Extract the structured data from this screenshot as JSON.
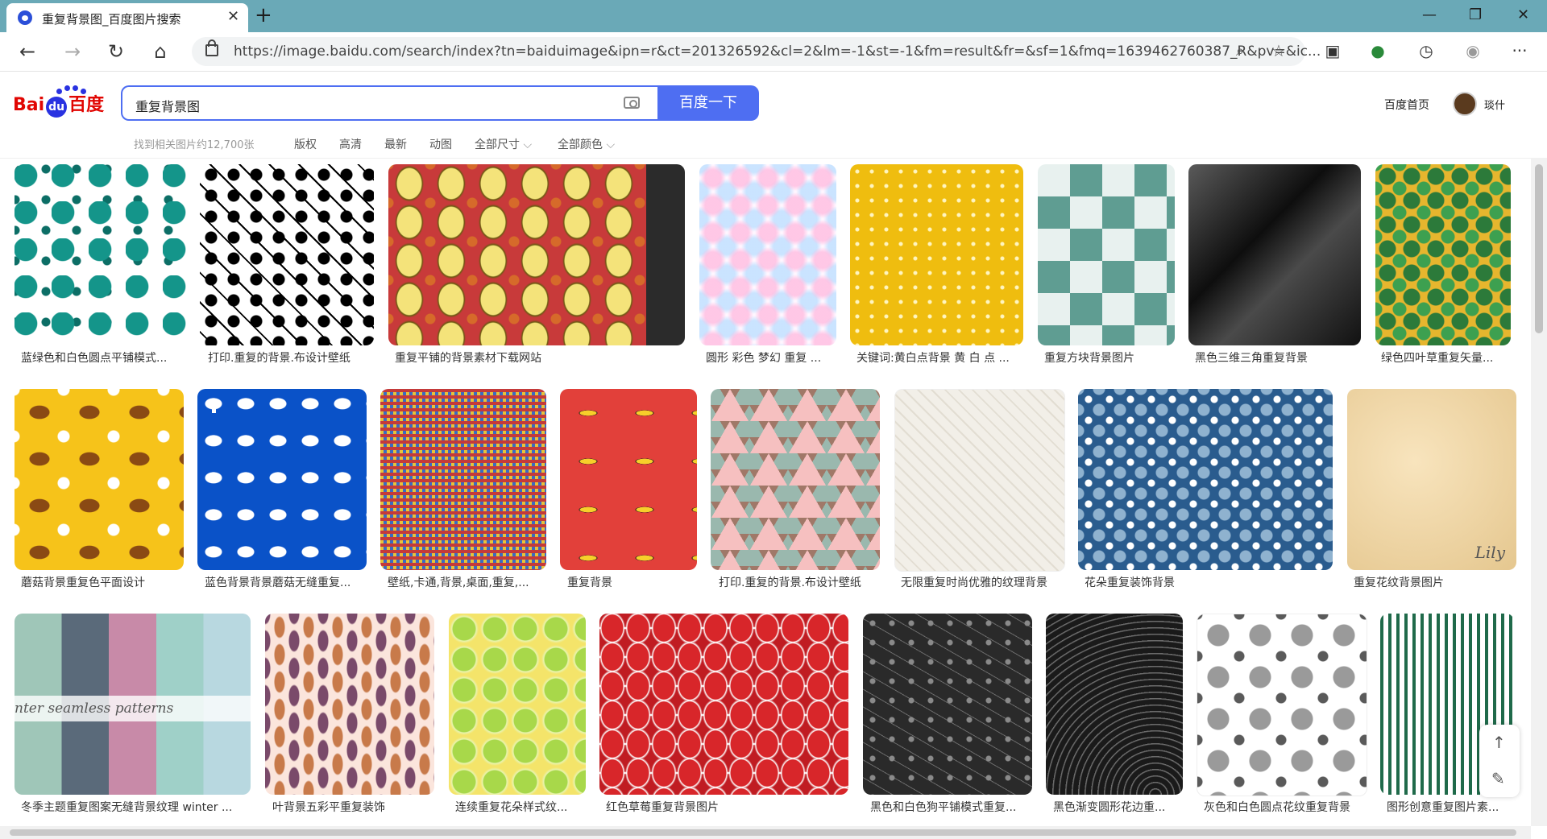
{
  "browser": {
    "tab_title": "重复背景图_百度图片搜索",
    "tab_close": "✕",
    "new_tab": "+",
    "url": "https://image.baidu.com/search/index?tn=baiduimage&ipn=r&ct=201326592&cl=2&lm=-1&st=-1&fm=result&fr=&sf=1&fmq=1639462760387_R&pv=&ic...",
    "window_controls": [
      "—",
      "❐",
      "✕"
    ],
    "nav": [
      "←",
      "→",
      "↻",
      "⌂"
    ],
    "toolbar_icons": [
      "collections-icon",
      "extension-icon",
      "history-icon",
      "profile-icon",
      "more-icon"
    ],
    "more_label": "···"
  },
  "header": {
    "logo_bai": "Bai",
    "logo_du": "du",
    "logo_cn": "百度",
    "query": "重复背景图",
    "search_button": "百度一下",
    "home_link": "百度首页",
    "username": "琰什"
  },
  "filters": {
    "result_count": "找到相关图片约12,700张",
    "items": [
      "版权",
      "高清",
      "最新",
      "动图",
      "全部尺寸",
      "全部颜色"
    ]
  },
  "colors": {
    "accent": "#4e6ef2",
    "logo_red": "#e10602",
    "tab_strip": "#6aa9b7"
  },
  "results": [
    {
      "caption": "蓝绿色和白色圆点平铺模式...",
      "style": "dots-teal"
    },
    {
      "caption": "打印.重复的背景.布设计壁纸",
      "style": "stars-bw"
    },
    {
      "caption": "重复平铺的背景素材下载网站",
      "style": "lemons-red"
    },
    {
      "caption": "圆形 彩色 梦幻 重复 ...",
      "style": "pastel"
    },
    {
      "caption": "关键词:黄白点背景 黄 白 点 ...",
      "style": "yellow-dots"
    },
    {
      "caption": "重复方块背景图片",
      "style": "teal-check"
    },
    {
      "caption": "黑色三维三角重复背景",
      "style": "black-poly"
    },
    {
      "caption": "绿色四叶草重复矢量...",
      "style": "clover"
    },
    {
      "caption": "蘑菇背景重复色平面设计",
      "style": "mushroom-yellow"
    },
    {
      "caption": "蓝色背景背景蘑菇无缝重复...",
      "style": "mushroom-blue"
    },
    {
      "caption": "壁纸,卡通,背景,桌面,重复,...",
      "style": "mosaic"
    },
    {
      "caption": "重复背景",
      "style": "banana"
    },
    {
      "caption": "打印.重复的背景.布设计壁纸",
      "style": "triangles"
    },
    {
      "caption": "无限重复时尚优雅的纹理背景",
      "style": "lattice"
    },
    {
      "caption": "花朵重复装饰背景",
      "style": "blue-floral"
    },
    {
      "caption": "重复花纹背景图片",
      "style": "beige",
      "watermark": "Lily"
    },
    {
      "caption": "冬季主题重复图案无缝背景纹理 winter ...",
      "style": "winter",
      "overlay": "nter seamless patterns"
    },
    {
      "caption": "叶背景五彩平重复装饰",
      "style": "leaves"
    },
    {
      "caption": "连续重复花朵样式纹...",
      "style": "lime"
    },
    {
      "caption": "红色草莓重复背景图片",
      "style": "strawberry"
    },
    {
      "caption": "黑色和白色狗平铺模式重复...",
      "style": "dogs"
    },
    {
      "caption": "黑色渐变圆形花边重...",
      "style": "dark-radial"
    },
    {
      "caption": "灰色和白色圆点花纹重复背景",
      "style": "grey-dots"
    },
    {
      "caption": "图形创意重复图片素...",
      "style": "green-creative"
    }
  ],
  "backtop": {
    "up": "↑",
    "edit": "✎"
  }
}
